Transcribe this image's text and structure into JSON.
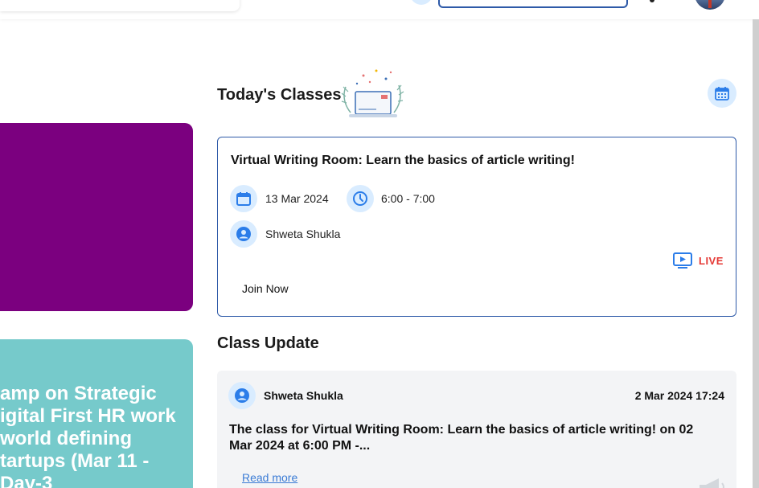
{
  "todays_classes": {
    "title": "Today's Classes",
    "class": {
      "title": "Virtual Writing Room: Learn the basics of article writing!",
      "date": "13 Mar 2024",
      "time": "6:00 - 7:00",
      "instructor": "Shweta Shukla",
      "status": "LIVE",
      "join_label": "Join Now"
    }
  },
  "class_update": {
    "title": "Class Update",
    "author": "Shweta Shukla",
    "timestamp": "2 Mar 2024 17:24",
    "message": "The class for Virtual Writing Room: Learn the basics of article writing! on 02 Mar 2024 at 6:00 PM -...",
    "read_more": "Read more"
  },
  "banners": {
    "teal_text": "amp on Strategic\nigital First HR work\nworld defining\ntartups (Mar 11 -\nDay-3"
  },
  "colors": {
    "accent_blue": "#2e5aa8",
    "icon_bg": "#d9ecff",
    "live_red": "#e53935",
    "purple_banner": "#7b007f",
    "teal_banner": "#76cacb"
  }
}
